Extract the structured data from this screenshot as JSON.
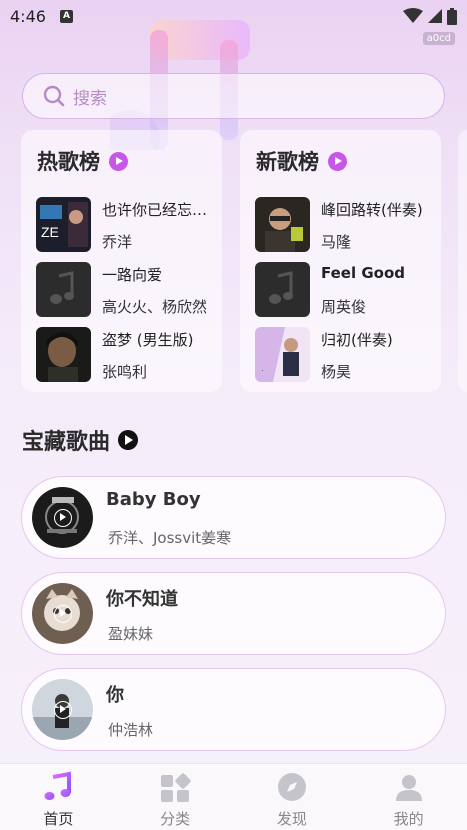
{
  "status_bar": {
    "time": "4:46",
    "tag": "a0cd"
  },
  "search": {
    "placeholder": "搜索"
  },
  "hot_chart": {
    "title": "热歌榜",
    "songs": [
      {
        "title": "也许你已经忘记我",
        "artist": "乔洋"
      },
      {
        "title": "一路向爱",
        "artist": "高火火、杨欣然"
      },
      {
        "title": "盗梦 (男生版)",
        "artist": "张鸣利"
      }
    ]
  },
  "new_chart": {
    "title": "新歌榜",
    "songs": [
      {
        "title": "峰回路转(伴奏)",
        "artist": "马隆"
      },
      {
        "title": "Feel Good",
        "artist": "周英俊"
      },
      {
        "title": "归初(伴奏)",
        "artist": "杨昊"
      }
    ]
  },
  "treasure": {
    "title": "宝藏歌曲",
    "tracks": [
      {
        "title": "Baby Boy",
        "artist": "乔洋、Jossvit姜寒"
      },
      {
        "title": "你不知道",
        "artist": "盈妹妹"
      },
      {
        "title": "你",
        "artist": "仲浩林"
      }
    ]
  },
  "bottom_nav": {
    "items": [
      {
        "label": "首页",
        "icon": "music-note-icon",
        "active": true
      },
      {
        "label": "分类",
        "icon": "category-icon",
        "active": false
      },
      {
        "label": "发现",
        "icon": "compass-icon",
        "active": false
      },
      {
        "label": "我的",
        "icon": "user-icon",
        "active": false
      }
    ]
  },
  "colors": {
    "accent": "#c757e6",
    "background": "#efe0f6",
    "search_border": "#d9b6e6"
  }
}
